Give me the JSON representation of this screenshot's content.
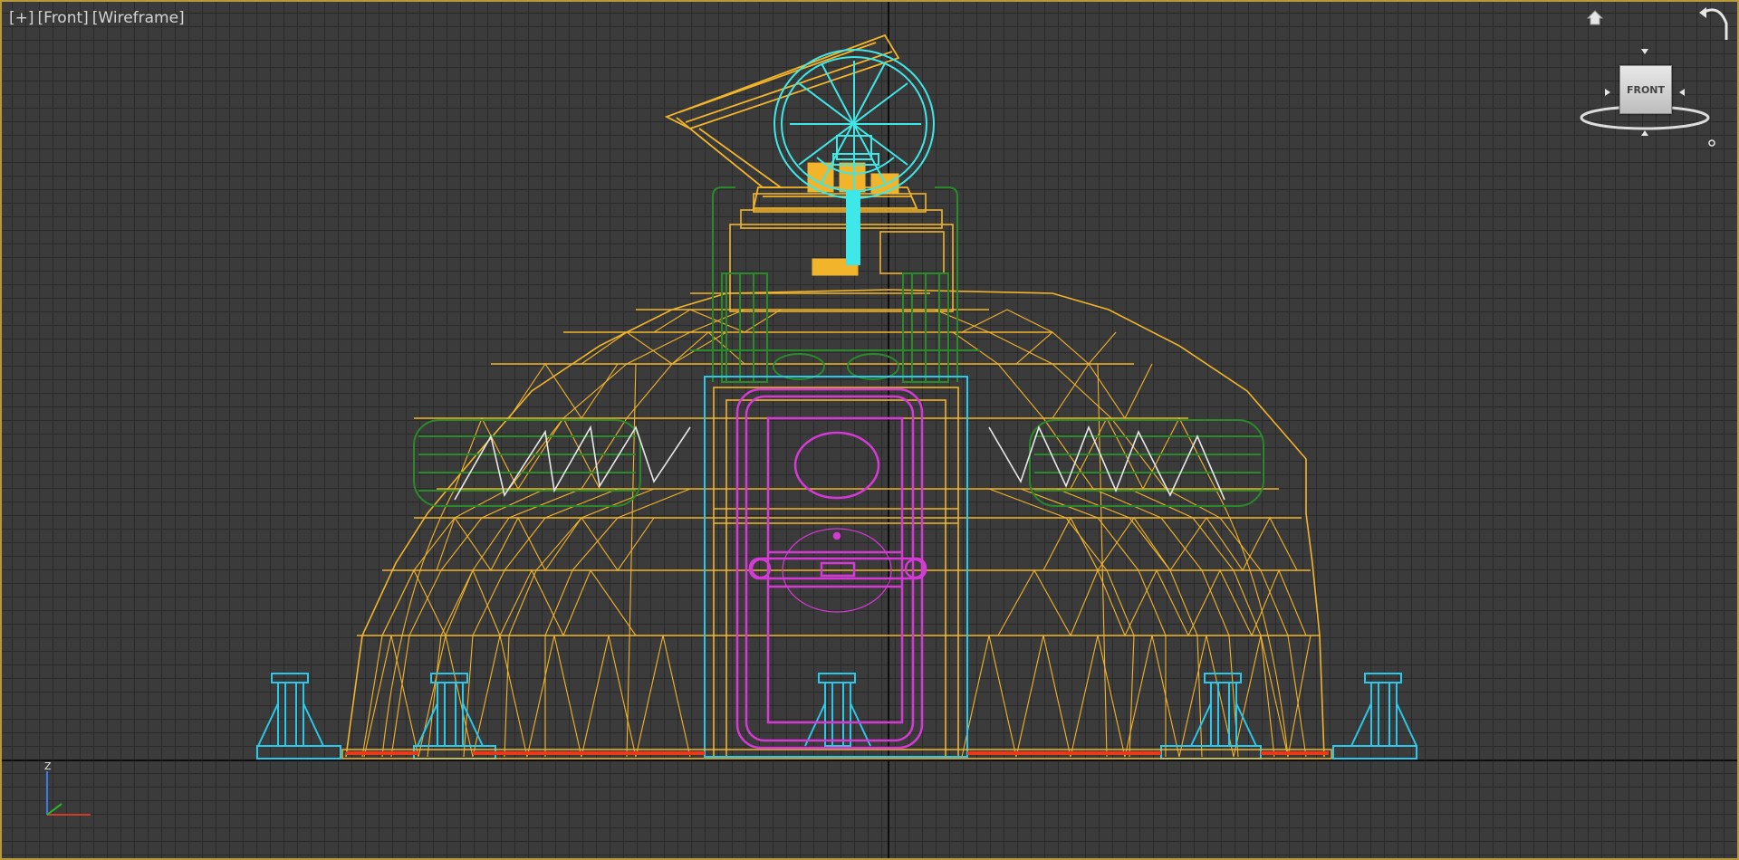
{
  "viewport": {
    "label_plus": "[+]",
    "label_view": "[Front]",
    "label_shading": "[Wireframe]",
    "border_color": "#b89a3c",
    "background_color": "#3b3b3b"
  },
  "viewcube": {
    "face_label": "FRONT"
  },
  "axis_tripod": {
    "z_label": "Z"
  },
  "scene_colors": {
    "dome": "#f2b42a",
    "supports": "#2ac8ea",
    "door": "#d63ad6",
    "green_parts": "#2a8a2a",
    "base_strip": "#e83a1a",
    "wheel": "#3ee8e8",
    "inner_lines": "#e8e8e8"
  },
  "icons": [
    "home-icon",
    "orbit-icon",
    "viewcube-icon",
    "axis-tripod-icon"
  ]
}
